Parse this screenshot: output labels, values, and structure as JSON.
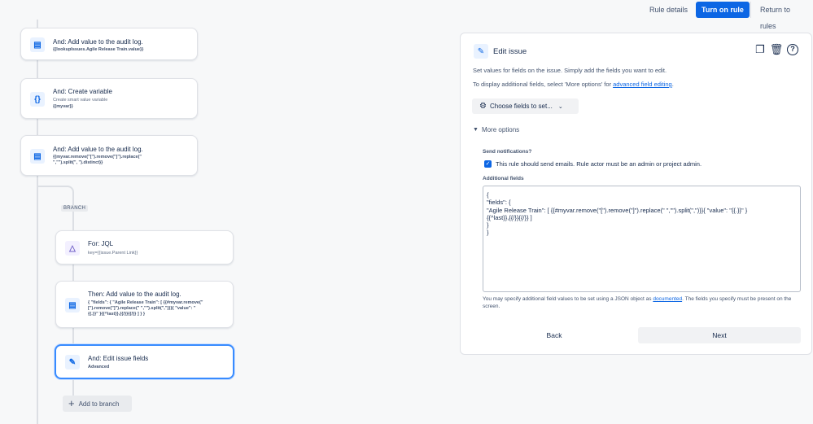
{
  "topbar": {
    "rule_details": "Rule details",
    "turn_on_rule": "Turn on rule",
    "return_to_rules": "Return to rules"
  },
  "flow": {
    "cards": [
      {
        "title": "And: Add value to the audit log.",
        "sub": "{{lookupIssues.Agile Release Train.value}}",
        "icon": "document-icon"
      },
      {
        "title": "And: Create variable",
        "sub_light": "Create smart value variable",
        "sub": "{{myvar}}",
        "icon": "braces-icon"
      },
      {
        "title": "And: Add value to the audit log.",
        "sub": "{{myvar.remove(\"[\").remove(\"]\").replace(\"\n\",\"\").split(\", \").distinct}}",
        "icon": "document-icon"
      }
    ],
    "branch_label": "BRANCH",
    "branch_cards": [
      {
        "title": "For: JQL",
        "sub_light": "key={{issue.Parent Link}}",
        "icon": "hierarchy-icon"
      },
      {
        "title": "Then: Add value to the audit log.",
        "sub": "{ \"fields\": { \"Agile Release Train\": [ {{#myvar.remove(\"\n[\").remove(\"]\").replace(\" \",\"\").split(\",\")}}{ \"value\": \"\n{{.}}\" }{{^last}},{{/}}{{/}} ] } }",
        "icon": "document-icon"
      },
      {
        "title": "And: Edit issue fields",
        "sub": "Advanced",
        "icon": "pencil-icon"
      }
    ],
    "add_to_branch": "Add to branch"
  },
  "panel": {
    "title": "Edit issue",
    "desc1": "Set values for fields on the issue. Simply add the fields you want to edit.",
    "desc2_prefix": "To display additional fields, select 'More options' for ",
    "desc2_link": "advanced field editing",
    "desc2_suffix": ".",
    "choose_fields": "Choose fields to set...",
    "more_options": "More options",
    "send_notifications_label": "Send notifications?",
    "send_notifications_text": "This rule should send emails. Rule actor must be an admin or project admin.",
    "send_notifications_checked": true,
    "additional_fields_label": "Additional fields",
    "additional_fields_value": "{\n\"fields\": {\n\"Agile Release Train\": [ {{#myvar.remove(\"[\").remove(\"]\").replace(\" \",\"\").split(\",\")}}{ \"value\": \"{{.}}\" }\n{{^last}},{{/}}{{/}} ]\n}\n}",
    "hint_prefix": "You may specify additional field values to be set using a JSON object as ",
    "hint_link": "documented",
    "hint_suffix": ". The fields you specify must be present on the screen.",
    "back": "Back",
    "next": "Next"
  },
  "colors": {
    "primary": "#0c66e4",
    "selected_border": "#388bff"
  }
}
